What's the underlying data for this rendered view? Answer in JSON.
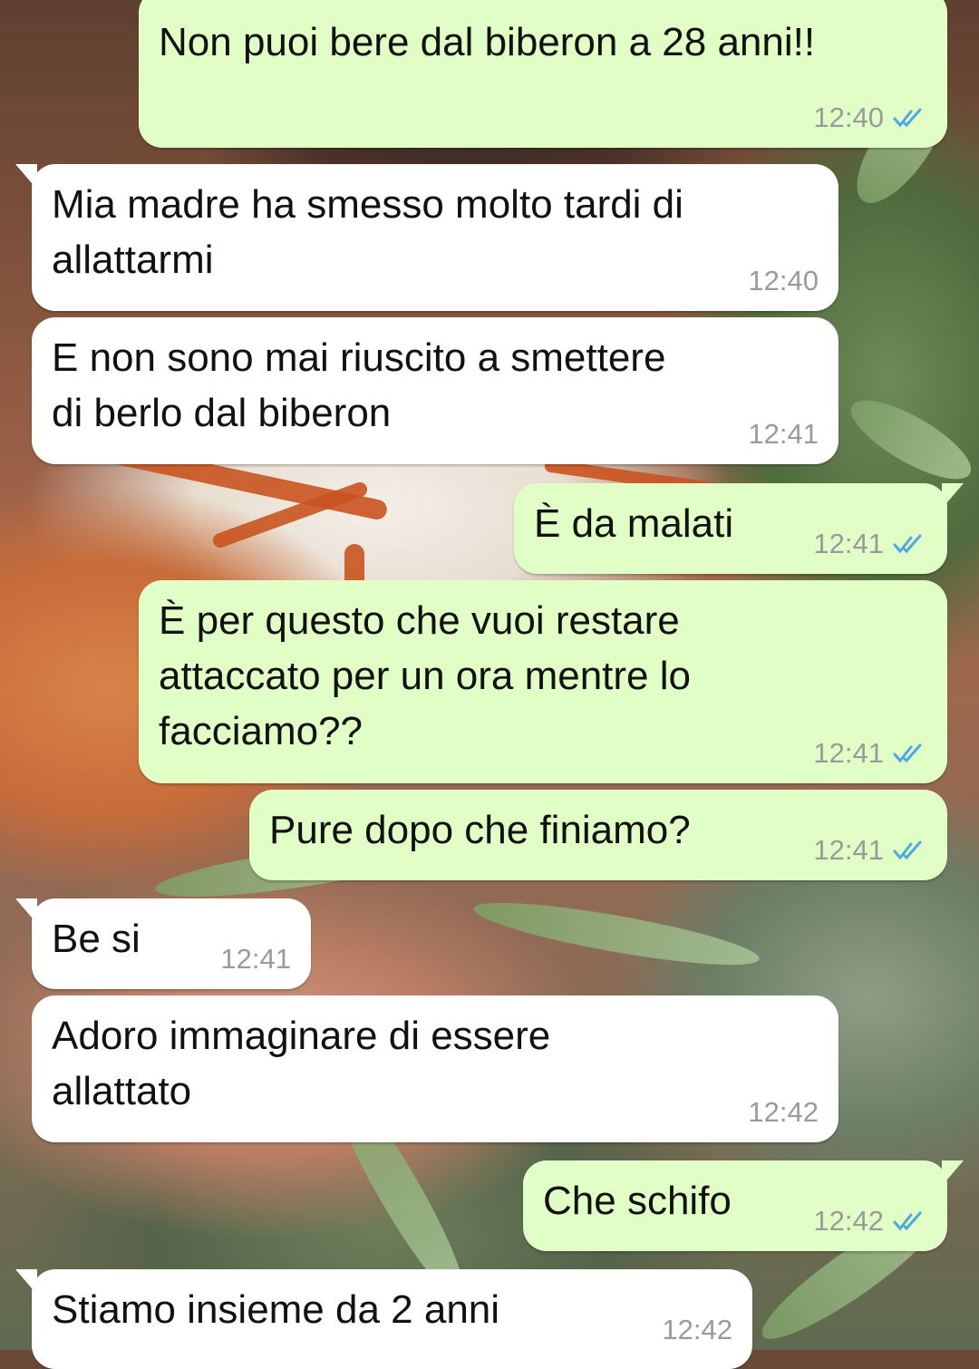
{
  "chat": {
    "messages": [
      {
        "direction": "outgoing",
        "text": "Non puoi bere dal biberon a 28 anni!!",
        "time": "12:40",
        "status": "read"
      },
      {
        "direction": "incoming",
        "text": "Mia madre ha smesso molto tardi di\nallattarmi",
        "time": "12:40"
      },
      {
        "direction": "incoming",
        "text": "E non sono mai riuscito a smettere\ndi berlo dal biberon",
        "time": "12:41"
      },
      {
        "direction": "outgoing",
        "text": "È da malati",
        "time": "12:41",
        "status": "read"
      },
      {
        "direction": "outgoing",
        "text": "È per questo che vuoi restare\nattaccato per un ora mentre lo\nfacciamo??",
        "time": "12:41",
        "status": "read"
      },
      {
        "direction": "outgoing",
        "text": "Pure dopo che finiamo?",
        "time": "12:41",
        "status": "read"
      },
      {
        "direction": "incoming",
        "text": "Be si",
        "time": "12:41"
      },
      {
        "direction": "incoming",
        "text": "Adoro immaginare di essere\nallattato",
        "time": "12:42"
      },
      {
        "direction": "outgoing",
        "text": "Che schifo",
        "time": "12:42",
        "status": "read"
      },
      {
        "direction": "incoming",
        "text": "Stiamo insieme da 2 anni",
        "time": "12:42"
      }
    ]
  },
  "icons": {
    "read_receipt": "double-check-icon"
  },
  "colors": {
    "outgoing_bubble": "#e1fec6",
    "incoming_bubble": "#ffffff",
    "read_tick": "#4fa8e0",
    "time_text": "#9a9a9a"
  }
}
